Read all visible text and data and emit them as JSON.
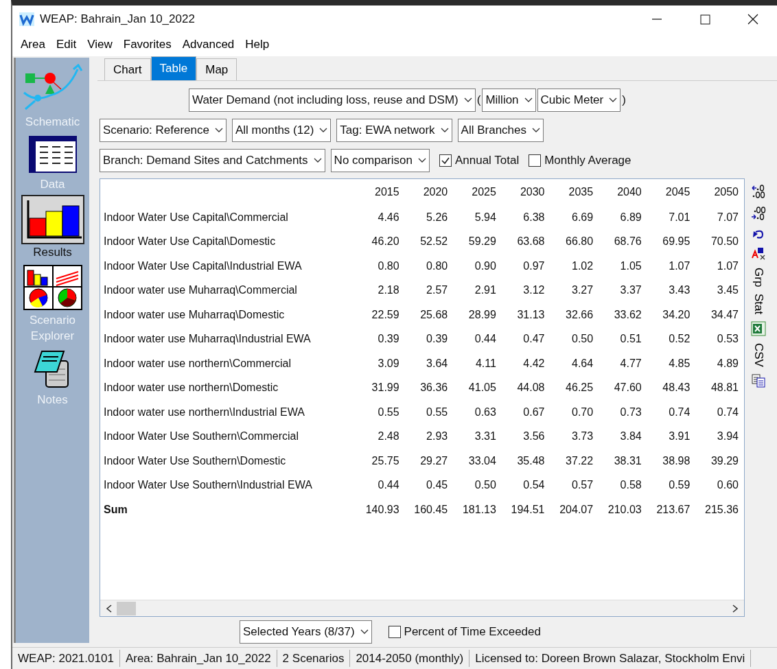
{
  "window": {
    "title": "WEAP: Bahrain_Jan 10_2022"
  },
  "menu": [
    "Area",
    "Edit",
    "View",
    "Favorites",
    "Advanced",
    "Help"
  ],
  "sidebar": {
    "items": [
      {
        "kind": "schematic",
        "label": "Schematic",
        "selected": false
      },
      {
        "kind": "data",
        "label": "Data",
        "selected": false
      },
      {
        "kind": "results",
        "label": "Results",
        "selected": true
      },
      {
        "kind": "explorer",
        "label": "Scenario Explorer",
        "selected": false
      },
      {
        "kind": "notes",
        "label": "Notes",
        "selected": false
      }
    ]
  },
  "tabs": [
    {
      "label": "Chart",
      "selected": false
    },
    {
      "label": "Table",
      "selected": true
    },
    {
      "label": "Map",
      "selected": false
    }
  ],
  "filter_rows": [
    [
      {
        "kind": "dropdown",
        "value": "Water Demand (not including loss, reuse and DSM)"
      },
      {
        "kind": "text",
        "value": "("
      },
      {
        "kind": "dropdown",
        "value": "Million"
      },
      {
        "kind": "dropdown",
        "value": "Cubic Meter"
      },
      {
        "kind": "text",
        "value": ")"
      }
    ],
    [
      {
        "kind": "dropdown",
        "value": "Scenario: Reference"
      },
      {
        "kind": "dropdown",
        "value": "All months (12)"
      },
      {
        "kind": "dropdown",
        "value": "Tag: EWA network"
      },
      {
        "kind": "dropdown",
        "value": "All Branches"
      }
    ],
    [
      {
        "kind": "dropdown",
        "value": "Branch: Demand Sites and Catchments"
      },
      {
        "kind": "dropdown",
        "value": "No comparison"
      },
      {
        "kind": "checkbox",
        "value": "Annual Total",
        "checked": true
      },
      {
        "kind": "checkbox",
        "value": "Monthly Average",
        "checked": false
      }
    ]
  ],
  "table": {
    "columns": [
      "2015",
      "2020",
      "2025",
      "2030",
      "2035",
      "2040",
      "2045",
      "2050"
    ],
    "rows": [
      {
        "kind": "item",
        "name": "Indoor Water Use Capital\\Commercial",
        "values": [
          "4.46",
          "5.26",
          "5.94",
          "6.38",
          "6.69",
          "6.89",
          "7.01",
          "7.07"
        ]
      },
      {
        "kind": "item",
        "name": "Indoor Water Use Capital\\Domestic",
        "values": [
          "46.20",
          "52.52",
          "59.29",
          "63.68",
          "66.80",
          "68.76",
          "69.95",
          "70.50"
        ]
      },
      {
        "kind": "item",
        "name": "Indoor Water Use Capital\\Industrial EWA",
        "values": [
          "0.80",
          "0.80",
          "0.90",
          "0.97",
          "1.02",
          "1.05",
          "1.07",
          "1.07"
        ]
      },
      {
        "kind": "item",
        "name": "Indoor water use Muharraq\\Commercial",
        "values": [
          "2.18",
          "2.57",
          "2.91",
          "3.12",
          "3.27",
          "3.37",
          "3.43",
          "3.45"
        ]
      },
      {
        "kind": "item",
        "name": "Indoor water use Muharraq\\Domestic",
        "values": [
          "22.59",
          "25.68",
          "28.99",
          "31.13",
          "32.66",
          "33.62",
          "34.20",
          "34.47"
        ]
      },
      {
        "kind": "item",
        "name": "Indoor water use Muharraq\\Industrial EWA",
        "values": [
          "0.39",
          "0.39",
          "0.44",
          "0.47",
          "0.50",
          "0.51",
          "0.52",
          "0.53"
        ]
      },
      {
        "kind": "item",
        "name": "Indoor water use northern\\Commercial",
        "values": [
          "3.09",
          "3.64",
          "4.11",
          "4.42",
          "4.64",
          "4.77",
          "4.85",
          "4.89"
        ]
      },
      {
        "kind": "item",
        "name": "Indoor water use northern\\Domestic",
        "values": [
          "31.99",
          "36.36",
          "41.05",
          "44.08",
          "46.25",
          "47.60",
          "48.43",
          "48.81"
        ]
      },
      {
        "kind": "item",
        "name": "Indoor water use northern\\Industrial EWA",
        "values": [
          "0.55",
          "0.55",
          "0.63",
          "0.67",
          "0.70",
          "0.73",
          "0.74",
          "0.74"
        ]
      },
      {
        "kind": "item",
        "name": "Indoor Water Use Southern\\Commercial",
        "values": [
          "2.48",
          "2.93",
          "3.31",
          "3.56",
          "3.73",
          "3.84",
          "3.91",
          "3.94"
        ]
      },
      {
        "kind": "item",
        "name": "Indoor Water Use Southern\\Domestic",
        "values": [
          "25.75",
          "29.27",
          "33.04",
          "35.48",
          "37.22",
          "38.31",
          "38.98",
          "39.29"
        ]
      },
      {
        "kind": "item",
        "name": "Indoor Water Use Southern\\Industrial EWA",
        "values": [
          "0.44",
          "0.45",
          "0.50",
          "0.54",
          "0.57",
          "0.58",
          "0.59",
          "0.60"
        ]
      },
      {
        "kind": "total",
        "name": "Sum",
        "values": [
          "140.93",
          "160.45",
          "181.13",
          "194.51",
          "204.07",
          "210.03",
          "213.67",
          "215.36"
        ]
      }
    ]
  },
  "side_tools": [
    {
      "kind": "more-decimals"
    },
    {
      "kind": "fewer-decimals"
    },
    {
      "kind": "undo"
    },
    {
      "kind": "font"
    },
    {
      "kind": "text",
      "label": "Grp"
    },
    {
      "kind": "text",
      "label": "Stat"
    },
    {
      "kind": "excel"
    },
    {
      "kind": "text",
      "label": "CSV"
    },
    {
      "kind": "copy"
    }
  ],
  "bottom": {
    "years": "Selected Years (8/37)",
    "exceeded": {
      "label": "Percent of Time Exceeded",
      "checked": false
    }
  },
  "status_bar": [
    "WEAP: 2021.0101",
    "Area: Bahrain_Jan 10_2022",
    "2 Scenarios",
    "2014-2050 (monthly)",
    "Licensed to: Doreen Brown Salazar, Stockholm Envi"
  ]
}
